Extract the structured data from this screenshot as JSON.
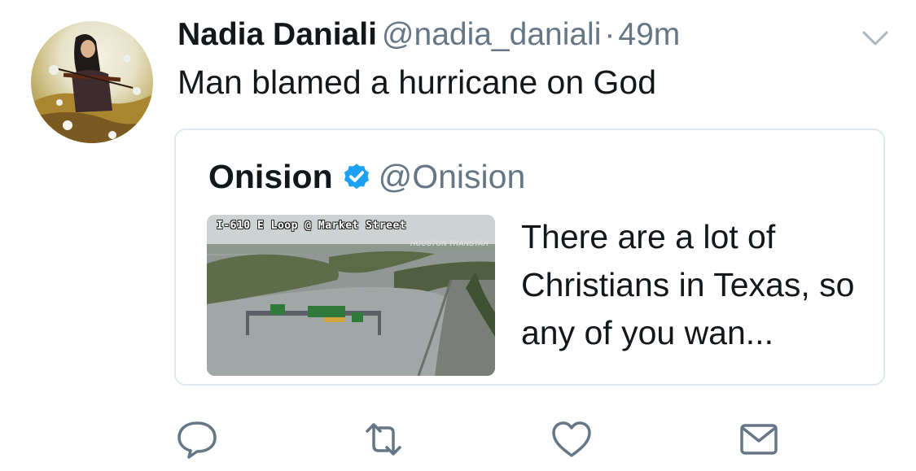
{
  "tweet": {
    "author_name": "Nadia Daniali",
    "author_handle": "@nadia_daniali",
    "separator": "·",
    "time": "49m",
    "text": "Man blamed a hurricane on God"
  },
  "quoted_tweet": {
    "author_name": "Onision",
    "author_handle": "@Onision",
    "verified": true,
    "text": "There are a lot of Christians in Texas, so any of you wan...",
    "media": {
      "camera_label": "I-610 E Loop @ Market Street",
      "logo_text": "HOUSTON TRANSTAR"
    }
  },
  "icons": {
    "caret": "chevron-down-icon",
    "reply": "speech-bubble-icon",
    "retweet": "retweet-icon",
    "like": "heart-icon",
    "message": "envelope-icon",
    "verified": "verified-badge-icon"
  },
  "colors": {
    "text": "#14171a",
    "secondary": "#657786",
    "verified": "#1da1f2",
    "border": "#e1e8ed"
  }
}
